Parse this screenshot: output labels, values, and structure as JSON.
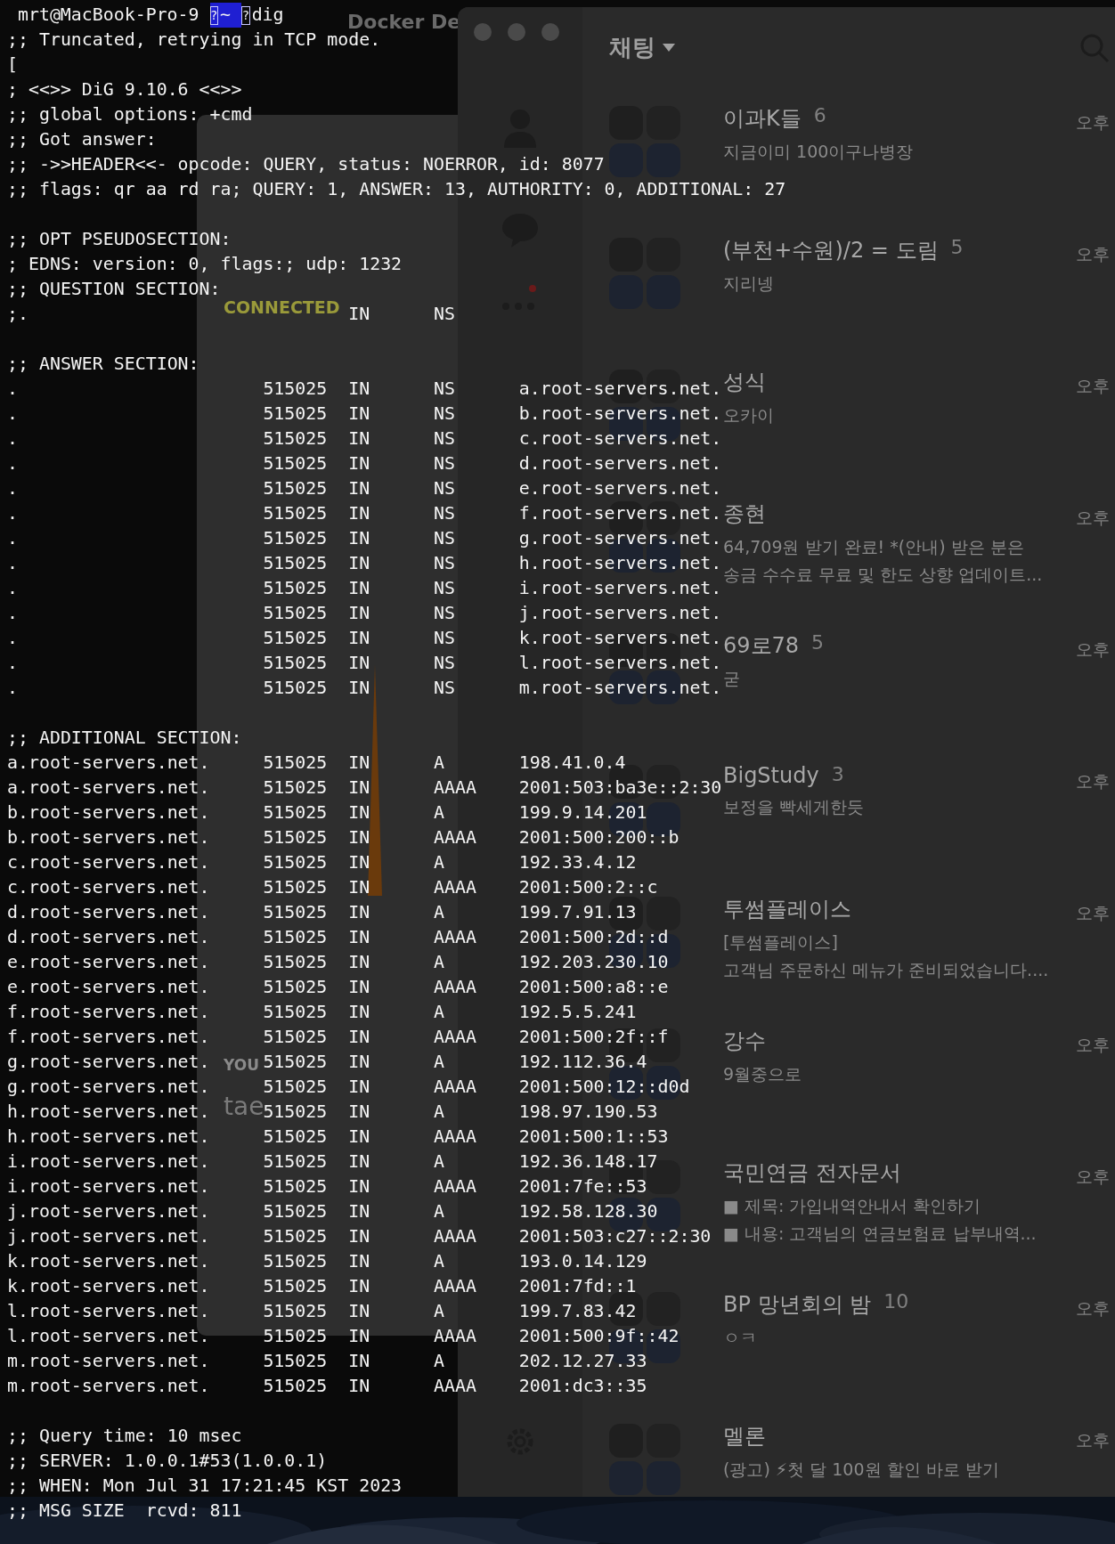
{
  "background": {
    "docker_title": "Docker De",
    "vpn": {
      "status": "CONNECTED",
      "you_label": "YOU",
      "user": "tae"
    },
    "chat": {
      "title": "채팅",
      "items": [
        {
          "name": "이과K들",
          "count": "6",
          "preview": [
            "지금이미 100이구나병장"
          ],
          "time": "오후"
        },
        {
          "name": "(부천+수원)/2 = 도림",
          "count": "5",
          "preview": [
            "지리넹"
          ],
          "time": "오후"
        },
        {
          "name": "성식",
          "preview": [
            "오카이"
          ],
          "time": "오후"
        },
        {
          "name": "종현",
          "preview": [
            "64,709원 받기 완료! *(안내) 받은 분은",
            "송금 수수료 무료 및 한도 상향 업데이트..."
          ],
          "time": "오후"
        },
        {
          "name": "69로78",
          "count": "5",
          "preview": [
            "굳"
          ],
          "time": "오후"
        },
        {
          "name": "BigStudy",
          "count": "3",
          "preview": [
            "보정을 빡세게한듯"
          ],
          "time": "오후"
        },
        {
          "name": "투썸플레이스",
          "preview": [
            "[투썸플레이스]",
            "고객님 주문하신 메뉴가 준비되었습니다...."
          ],
          "time": "오후"
        },
        {
          "name": "강수",
          "preview": [
            "9월중으로"
          ],
          "time": "오후"
        },
        {
          "name": "국민연금 전자문서",
          "preview": [
            "■ 제목: 가입내역안내서 확인하기",
            "■ 내용: 고객님의 연금보험료 납부내역..."
          ],
          "time": "오후"
        },
        {
          "name": "BP 망년회의 밤",
          "count": "10",
          "preview": [
            "ㅇㅋ"
          ],
          "time": "오후"
        },
        {
          "name": "멜론",
          "preview": [
            "(광고) ⚡첫 달 100원 할인 바로 받기"
          ],
          "time": "오후"
        }
      ]
    }
  },
  "terminal": {
    "prompt": {
      "user_host": "mrt@MacBook-Pro-9",
      "segment_glyph": "?",
      "directory": "~",
      "command_glyph": "?",
      "command": "dig"
    },
    "lines": [
      {
        "kind": "text",
        "text": ";; Truncated, retrying in TCP mode."
      },
      {
        "kind": "text",
        "text": "["
      },
      {
        "kind": "text",
        "text": "; <<>> DiG 9.10.6 <<>>"
      },
      {
        "kind": "text",
        "text": ";; global options: +cmd"
      },
      {
        "kind": "text",
        "text": ";; Got answer:"
      },
      {
        "kind": "text",
        "text": ";; ->>HEADER<<- opcode: QUERY, status: NOERROR, id: 8077"
      },
      {
        "kind": "text",
        "text": ";; flags: qr aa rd ra; QUERY: 1, ANSWER: 13, AUTHORITY: 0, ADDITIONAL: 27"
      },
      {
        "kind": "blank"
      },
      {
        "kind": "text",
        "text": ";; OPT PSEUDOSECTION:"
      },
      {
        "kind": "text",
        "text": "; EDNS: version: 0, flags:; udp: 1232"
      },
      {
        "kind": "text",
        "text": ";; QUESTION SECTION:"
      },
      {
        "kind": "record",
        "name": ";.",
        "class": "IN",
        "type": "NS"
      },
      {
        "kind": "blank"
      },
      {
        "kind": "text",
        "text": ";; ANSWER SECTION:"
      },
      {
        "kind": "record",
        "name": ".",
        "ttl": "515025",
        "class": "IN",
        "type": "NS",
        "data": "a.root-servers.net."
      },
      {
        "kind": "record",
        "name": ".",
        "ttl": "515025",
        "class": "IN",
        "type": "NS",
        "data": "b.root-servers.net."
      },
      {
        "kind": "record",
        "name": ".",
        "ttl": "515025",
        "class": "IN",
        "type": "NS",
        "data": "c.root-servers.net."
      },
      {
        "kind": "record",
        "name": ".",
        "ttl": "515025",
        "class": "IN",
        "type": "NS",
        "data": "d.root-servers.net."
      },
      {
        "kind": "record",
        "name": ".",
        "ttl": "515025",
        "class": "IN",
        "type": "NS",
        "data": "e.root-servers.net."
      },
      {
        "kind": "record",
        "name": ".",
        "ttl": "515025",
        "class": "IN",
        "type": "NS",
        "data": "f.root-servers.net."
      },
      {
        "kind": "record",
        "name": ".",
        "ttl": "515025",
        "class": "IN",
        "type": "NS",
        "data": "g.root-servers.net."
      },
      {
        "kind": "record",
        "name": ".",
        "ttl": "515025",
        "class": "IN",
        "type": "NS",
        "data": "h.root-servers.net."
      },
      {
        "kind": "record",
        "name": ".",
        "ttl": "515025",
        "class": "IN",
        "type": "NS",
        "data": "i.root-servers.net."
      },
      {
        "kind": "record",
        "name": ".",
        "ttl": "515025",
        "class": "IN",
        "type": "NS",
        "data": "j.root-servers.net."
      },
      {
        "kind": "record",
        "name": ".",
        "ttl": "515025",
        "class": "IN",
        "type": "NS",
        "data": "k.root-servers.net."
      },
      {
        "kind": "record",
        "name": ".",
        "ttl": "515025",
        "class": "IN",
        "type": "NS",
        "data": "l.root-servers.net."
      },
      {
        "kind": "record",
        "name": ".",
        "ttl": "515025",
        "class": "IN",
        "type": "NS",
        "data": "m.root-servers.net."
      },
      {
        "kind": "blank"
      },
      {
        "kind": "text",
        "text": ";; ADDITIONAL SECTION:"
      },
      {
        "kind": "record",
        "name": "a.root-servers.net.",
        "ttl": "515025",
        "class": "IN",
        "type": "A",
        "data": "198.41.0.4"
      },
      {
        "kind": "record",
        "name": "a.root-servers.net.",
        "ttl": "515025",
        "class": "IN",
        "type": "AAAA",
        "data": "2001:503:ba3e::2:30"
      },
      {
        "kind": "record",
        "name": "b.root-servers.net.",
        "ttl": "515025",
        "class": "IN",
        "type": "A",
        "data": "199.9.14.201"
      },
      {
        "kind": "record",
        "name": "b.root-servers.net.",
        "ttl": "515025",
        "class": "IN",
        "type": "AAAA",
        "data": "2001:500:200::b"
      },
      {
        "kind": "record",
        "name": "c.root-servers.net.",
        "ttl": "515025",
        "class": "IN",
        "type": "A",
        "data": "192.33.4.12"
      },
      {
        "kind": "record",
        "name": "c.root-servers.net.",
        "ttl": "515025",
        "class": "IN",
        "type": "AAAA",
        "data": "2001:500:2::c"
      },
      {
        "kind": "record",
        "name": "d.root-servers.net.",
        "ttl": "515025",
        "class": "IN",
        "type": "A",
        "data": "199.7.91.13"
      },
      {
        "kind": "record",
        "name": "d.root-servers.net.",
        "ttl": "515025",
        "class": "IN",
        "type": "AAAA",
        "data": "2001:500:2d::d"
      },
      {
        "kind": "record",
        "name": "e.root-servers.net.",
        "ttl": "515025",
        "class": "IN",
        "type": "A",
        "data": "192.203.230.10"
      },
      {
        "kind": "record",
        "name": "e.root-servers.net.",
        "ttl": "515025",
        "class": "IN",
        "type": "AAAA",
        "data": "2001:500:a8::e"
      },
      {
        "kind": "record",
        "name": "f.root-servers.net.",
        "ttl": "515025",
        "class": "IN",
        "type": "A",
        "data": "192.5.5.241"
      },
      {
        "kind": "record",
        "name": "f.root-servers.net.",
        "ttl": "515025",
        "class": "IN",
        "type": "AAAA",
        "data": "2001:500:2f::f"
      },
      {
        "kind": "record",
        "name": "g.root-servers.net.",
        "ttl": "515025",
        "class": "IN",
        "type": "A",
        "data": "192.112.36.4"
      },
      {
        "kind": "record",
        "name": "g.root-servers.net.",
        "ttl": "515025",
        "class": "IN",
        "type": "AAAA",
        "data": "2001:500:12::d0d"
      },
      {
        "kind": "record",
        "name": "h.root-servers.net.",
        "ttl": "515025",
        "class": "IN",
        "type": "A",
        "data": "198.97.190.53"
      },
      {
        "kind": "record",
        "name": "h.root-servers.net.",
        "ttl": "515025",
        "class": "IN",
        "type": "AAAA",
        "data": "2001:500:1::53"
      },
      {
        "kind": "record",
        "name": "i.root-servers.net.",
        "ttl": "515025",
        "class": "IN",
        "type": "A",
        "data": "192.36.148.17"
      },
      {
        "kind": "record",
        "name": "i.root-servers.net.",
        "ttl": "515025",
        "class": "IN",
        "type": "AAAA",
        "data": "2001:7fe::53"
      },
      {
        "kind": "record",
        "name": "j.root-servers.net.",
        "ttl": "515025",
        "class": "IN",
        "type": "A",
        "data": "192.58.128.30"
      },
      {
        "kind": "record",
        "name": "j.root-servers.net.",
        "ttl": "515025",
        "class": "IN",
        "type": "AAAA",
        "data": "2001:503:c27::2:30"
      },
      {
        "kind": "record",
        "name": "k.root-servers.net.",
        "ttl": "515025",
        "class": "IN",
        "type": "A",
        "data": "193.0.14.129"
      },
      {
        "kind": "record",
        "name": "k.root-servers.net.",
        "ttl": "515025",
        "class": "IN",
        "type": "AAAA",
        "data": "2001:7fd::1"
      },
      {
        "kind": "record",
        "name": "l.root-servers.net.",
        "ttl": "515025",
        "class": "IN",
        "type": "A",
        "data": "199.7.83.42"
      },
      {
        "kind": "record",
        "name": "l.root-servers.net.",
        "ttl": "515025",
        "class": "IN",
        "type": "AAAA",
        "data": "2001:500:9f::42"
      },
      {
        "kind": "record",
        "name": "m.root-servers.net.",
        "ttl": "515025",
        "class": "IN",
        "type": "A",
        "data": "202.12.27.33"
      },
      {
        "kind": "record",
        "name": "m.root-servers.net.",
        "ttl": "515025",
        "class": "IN",
        "type": "AAAA",
        "data": "2001:dc3::35"
      },
      {
        "kind": "blank"
      },
      {
        "kind": "text",
        "text": ";; Query time: 10 msec"
      },
      {
        "kind": "text",
        "text": ";; SERVER: 1.0.0.1#53(1.0.0.1)"
      },
      {
        "kind": "text",
        "text": ";; WHEN: Mon Jul 31 17:21:45 KST 2023"
      },
      {
        "kind": "text",
        "text": ";; MSG SIZE  rcvd: 811"
      }
    ]
  }
}
